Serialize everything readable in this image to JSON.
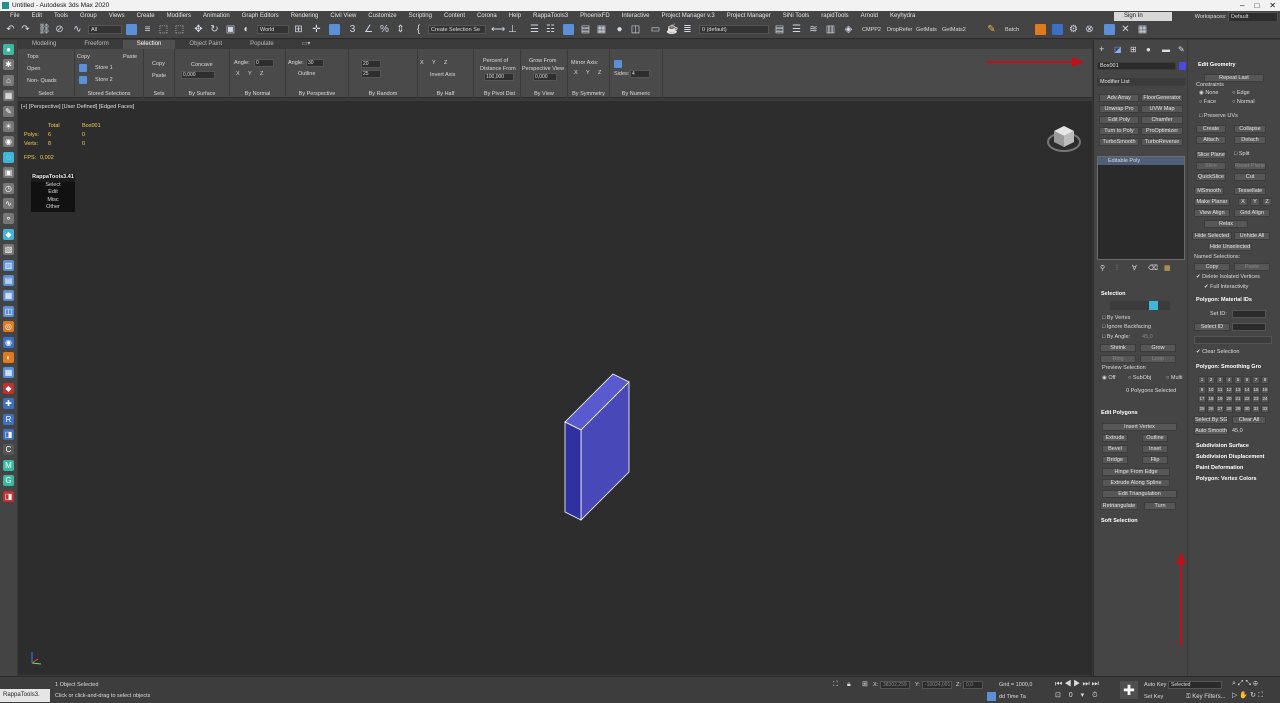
{
  "window": {
    "title": "Untitled - Autodesk 3ds Max 2020"
  },
  "menu": [
    "File",
    "Edit",
    "Tools",
    "Group",
    "Views",
    "Create",
    "Modifiers",
    "Animation",
    "Graph Editors",
    "Rendering",
    "Civil View",
    "Customize",
    "Scripting",
    "Content",
    "Corona",
    "Help",
    "RappaTools3",
    "PhoenixFD",
    "Interactive",
    "Project Manager v.3",
    "Project Manager",
    "SiNi Tools",
    "rapidTools",
    "Arnold",
    "Keyhydra"
  ],
  "account": {
    "signin": "Sign In",
    "workspaces_label": "Workspaces:",
    "workspace": "Default"
  },
  "toolbar": {
    "filter": "All",
    "coord": "World",
    "selset": "Create Selection Se",
    "layer": "0 (default)",
    "plugins": [
      "CMPP2",
      "DropRefer",
      "GetMats",
      "GetMats2"
    ],
    "batch": "Batch"
  },
  "ribbon": {
    "tabs": [
      "Modeling",
      "Freeform",
      "Selection",
      "Object Paint",
      "Populate"
    ],
    "active_tab": "Selection",
    "select": {
      "items": [
        "Tops",
        "Open",
        "Non- Quads"
      ],
      "label": "Select"
    },
    "stored": {
      "copy": "Copy",
      "paste": "Paste",
      "store1": "Store 1",
      "store2": "Store 2",
      "label": "Stored Selections"
    },
    "sets": {
      "copy": "Copy",
      "paste": "Paste",
      "label": "Sets"
    },
    "surface": {
      "mode": "Concave",
      "value": "0,000",
      "label": "By Surface"
    },
    "normal": {
      "angle_label": "Angle:",
      "angle": "0",
      "axes": [
        "X",
        "Y",
        "Z"
      ],
      "label": "By Normal"
    },
    "perspective": {
      "angle_label": "Angle:",
      "angle": "30",
      "outline": "Outline",
      "label": "By Perspective"
    },
    "random": {
      "v1": "20",
      "v2": "25",
      "label": "By Random"
    },
    "half": {
      "axes": [
        "X",
        "Y",
        "Z"
      ],
      "invert": "Invert Axis",
      "label": "By Half"
    },
    "pivot": {
      "line1": "Percent of",
      "line2": "Distance From",
      "value": "100,000",
      "label": "By Pivot Dist"
    },
    "view": {
      "line1": "Grow From",
      "line2": "Perspective View",
      "value": "0,000",
      "label": "By View"
    },
    "symmetry": {
      "title": "Mirror Axis:",
      "axes": [
        "X",
        "Y",
        "Z"
      ],
      "label": "By Symmetry"
    },
    "numeric": {
      "sides_label": "Sides:",
      "sides": "4",
      "label": "By Numeric"
    }
  },
  "viewport": {
    "label": "[+] [Perspective] [User Defined] [Edged Faces]",
    "stats": {
      "total": "Total",
      "object": "Box001",
      "polys_label": "Polys:",
      "polys_total": "6",
      "polys_obj": "0",
      "verts_label": "Verts:",
      "verts_total": "8",
      "verts_obj": "0",
      "fps_label": "FPS:",
      "fps": "0,002"
    },
    "rappa": {
      "title": "RappaTools3.41",
      "items": [
        "Select",
        "Edit",
        "Misc",
        "Other"
      ]
    }
  },
  "command_panel": {
    "object_name": "Box001",
    "modifier_list": "Modifier List",
    "quick_buttons": [
      [
        "Adv.Array",
        "FloorGenerator"
      ],
      [
        "Unwrap Pro",
        "UVW Map"
      ],
      [
        "Edit Poly",
        "Chamfer"
      ],
      [
        "Turn to Poly",
        "ProOptimizer"
      ],
      [
        "TurboSmooth",
        "TurboReverse"
      ]
    ],
    "stack_item": "Editable Poly",
    "selection": {
      "title": "Selection",
      "by_vertex": "By Vertex",
      "ignore_backfacing": "Ignore Backfacing",
      "by_angle": "By Angle:",
      "by_angle_value": "45,0",
      "shrink": "Shrink",
      "grow": "Grow",
      "ring": "Ring",
      "loop": "Loop",
      "preview": "Preview Selection",
      "off": "Off",
      "subobj": "SubObj",
      "multi": "Multi",
      "status": "0 Polygons Selected"
    },
    "edit_polygons": {
      "title": "Edit Polygons",
      "insert_vertex": "Insert Vertex",
      "extrude": "Extrude",
      "outline": "Outline",
      "bevel": "Bevel",
      "inset": "Inset",
      "bridge": "Bridge",
      "flip": "Flip",
      "hinge": "Hinge From Edge",
      "extrude_spline": "Extrude Along Spline",
      "edit_tri": "Edit Triangulation",
      "retriangulate": "Retriangulate",
      "turn": "Turn"
    },
    "soft_selection": "Soft Selection"
  },
  "edit_geometry": {
    "title": "Edit Geometry",
    "repeat_last": "Repeat Last",
    "constraints": "Constraints",
    "none": "None",
    "edge": "Edge",
    "face": "Face",
    "normal": "Normal",
    "preserve_uvs": "Preserve UVs",
    "create": "Create",
    "collapse": "Collapse",
    "attach": "Attach",
    "detach": "Detach",
    "slice_plane": "Slice Plane",
    "split": "Split",
    "slice": "Slice",
    "reset_plane": "Reset Plane",
    "quickslice": "QuickSlice",
    "cut": "Cut",
    "msmooth": "MSmooth",
    "tessellate": "Tessellate",
    "make_planar": "Make Planar",
    "x": "X",
    "y": "Y",
    "z": "Z",
    "view_align": "View Align",
    "grid_align": "Grid Align",
    "relax": "Relax",
    "hide_selected": "Hide Selected",
    "unhide_all": "Unhide All",
    "hide_unselected": "Hide Unselected",
    "named_selections": "Named Selections:",
    "copy": "Copy",
    "paste": "Paste",
    "delete_isolated": "Delete Isolated Vertices",
    "full_interactivity": "Full Interactivity"
  },
  "material_ids": {
    "title": "Polygon: Material IDs",
    "set_id": "Set ID:",
    "select_id": "Select ID",
    "clear_selection": "Clear Selection"
  },
  "smoothing": {
    "title": "Polygon: Smoothing Gro",
    "groups": [
      "1",
      "2",
      "3",
      "4",
      "5",
      "6",
      "7",
      "8",
      "9",
      "10",
      "11",
      "12",
      "13",
      "14",
      "15",
      "16",
      "17",
      "18",
      "19",
      "20",
      "21",
      "22",
      "23",
      "24",
      "25",
      "26",
      "27",
      "28",
      "29",
      "30",
      "31",
      "32"
    ],
    "select_by_sg": "Select By SG",
    "clear_all": "Clear All",
    "auto_smooth": "Auto Smooth",
    "auto_value": "45,0"
  },
  "rollouts": [
    "Subdivision Surface",
    "Subdivision Displacement",
    "Paint Deformation",
    "Polygon: Vertex Colors"
  ],
  "status": {
    "script_label": "RappaTools3.",
    "selection": "1 Object Selected",
    "prompt": "Click or click-and-drag to select objects",
    "x_label": "X:",
    "x_value": "38302,259",
    "y_label": "Y:",
    "y_value": "-10024,091",
    "z_label": "Z:",
    "z_value": "0,0",
    "grid": "Grid = 1000,0",
    "add_time_tag": "dd Time Ta",
    "auto_key": "Auto Key",
    "set_key": "Set Key",
    "selected": "Selected",
    "key_filters": "Key Filters..."
  },
  "colors": {
    "accent": "#5b8fd6",
    "box_face": "#4a4ab8",
    "annotation_arrow": "#c0101a"
  }
}
